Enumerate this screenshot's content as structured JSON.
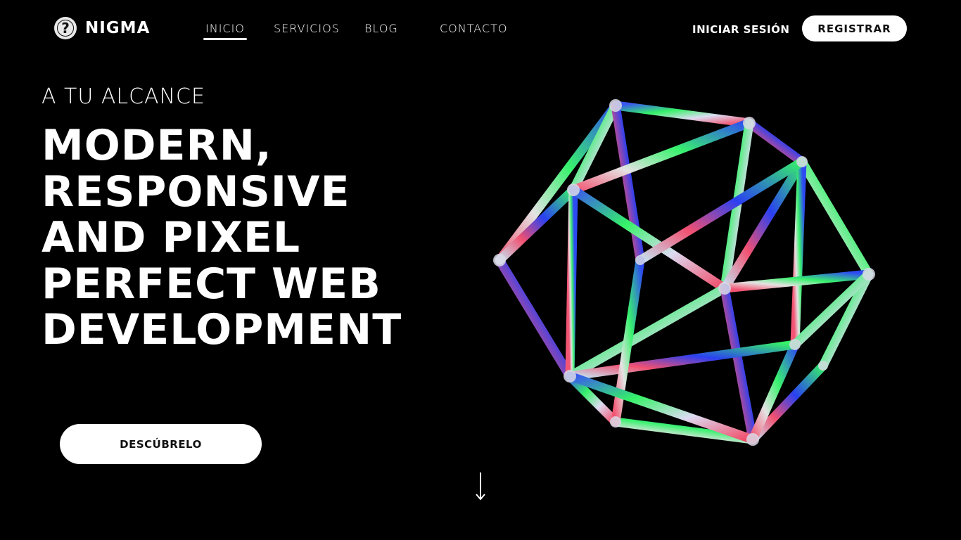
{
  "brand": {
    "name": "NIGMA",
    "logo_icon": "question-mark-icon"
  },
  "nav": {
    "items": [
      {
        "label": "INICIO",
        "active": true
      },
      {
        "label": "SERVICIOS",
        "active": false
      },
      {
        "label": "BLOG",
        "active": false
      },
      {
        "label": "CONTACTO",
        "active": false
      }
    ]
  },
  "auth": {
    "login_label": "INICIAR SESIÓN",
    "register_label": "REGISTRAR"
  },
  "hero": {
    "eyebrow": "A TU ALCANCE",
    "headline_lines": [
      "MODERN,",
      "RESPONSIVE",
      "AND PIXEL",
      "PERFECT WEB",
      "DEVELOPMENT"
    ],
    "cta_label": "DESCÚBRELO",
    "artwork": "iridescent-icosahedron-wireframe",
    "scroll_icon": "arrow-down-icon"
  },
  "colors": {
    "background": "#000000",
    "text": "#ffffff",
    "button_bg": "#ffffff",
    "button_text": "#111111"
  }
}
